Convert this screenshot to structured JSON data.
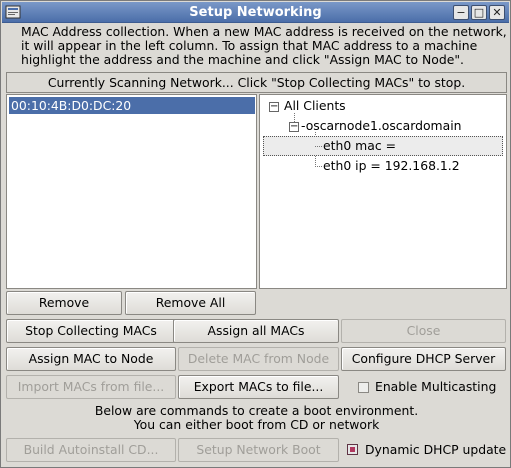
{
  "window": {
    "title": "Setup Networking",
    "minimize_glyph": "−",
    "maximize_glyph": "□",
    "close_glyph": "✕"
  },
  "intro": {
    "line1": "MAC Address collection.  When a new MAC address is received on the network,",
    "line2": "it will appear in the left column.  To assign that MAC address to a machine",
    "line3": "highlight the address and the machine and click \"Assign MAC to Node\"."
  },
  "status": "Currently Scanning Network... Click \"Stop Collecting MACs\" to stop.",
  "mac_list": {
    "items": [
      "00:10:4B:D0:DC:20"
    ]
  },
  "tree": {
    "root_label": "All Clients",
    "node_label": "oscarnode1.oscardomain",
    "children": [
      "eth0 mac =",
      "eth0 ip = 192.168.1.2"
    ],
    "collapse_glyph": "−"
  },
  "buttons": {
    "remove": "Remove",
    "remove_all": "Remove All",
    "stop_collecting": "Stop Collecting MACs",
    "assign_all": "Assign all MACs",
    "close": "Close",
    "assign_mac": "Assign MAC to Node",
    "delete_mac": "Delete MAC from Node",
    "configure_dhcp": "Configure DHCP Server",
    "import_macs": "Import MACs from file...",
    "export_macs": "Export MACs to file...",
    "build_autoinstall": "Build Autoinstall CD...",
    "setup_network_boot": "Setup Network Boot"
  },
  "checkboxes": {
    "multicasting": {
      "label": "Enable Multicasting",
      "checked": false
    },
    "dynamic_dhcp": {
      "label": "Dynamic DHCP update",
      "checked": true
    }
  },
  "boot_note": {
    "line1": "Below are commands to create a boot environment.",
    "line2": "You can either boot from CD or network"
  },
  "colors": {
    "titlebar": "#4b6ea9",
    "selection": "#4b6ea9",
    "checkbox_on": "#b0385f",
    "window_bg": "#dcdad5"
  }
}
